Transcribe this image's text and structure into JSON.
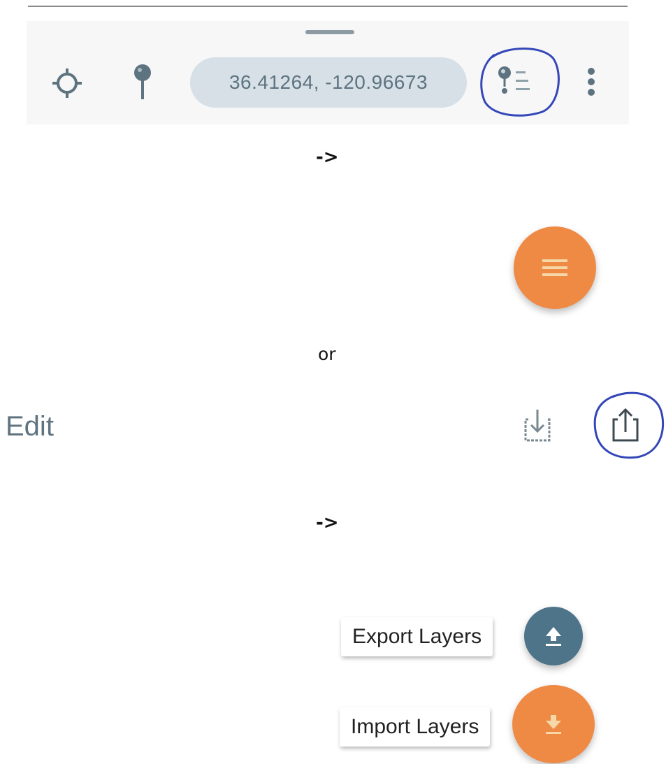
{
  "toolbar": {
    "coordinates": "36.41264, -120.96673",
    "icons": {
      "drag_handle": "drag-handle",
      "locate": "crosshair-icon",
      "drop_pin": "map-pin-icon",
      "legend": "legend-icon",
      "more": "more-vert-icon"
    }
  },
  "steps": {
    "arrow_1": "->",
    "or": "or",
    "arrow_2": "->"
  },
  "menu_fab": {
    "icon": "menu-icon"
  },
  "edit_bar": {
    "title": "Edit",
    "icons": {
      "import": "import-icon",
      "share": "share-icon"
    }
  },
  "fab_menu": {
    "export_label": "Export Layers",
    "import_label": "Import Layers",
    "icons": {
      "export": "upload-icon",
      "import": "download-icon"
    }
  },
  "colors": {
    "accent_orange": "#ef8a45",
    "accent_slate": "#4d7489",
    "pill_bg": "#d6e0e6",
    "annotation_blue": "#3447b8"
  }
}
